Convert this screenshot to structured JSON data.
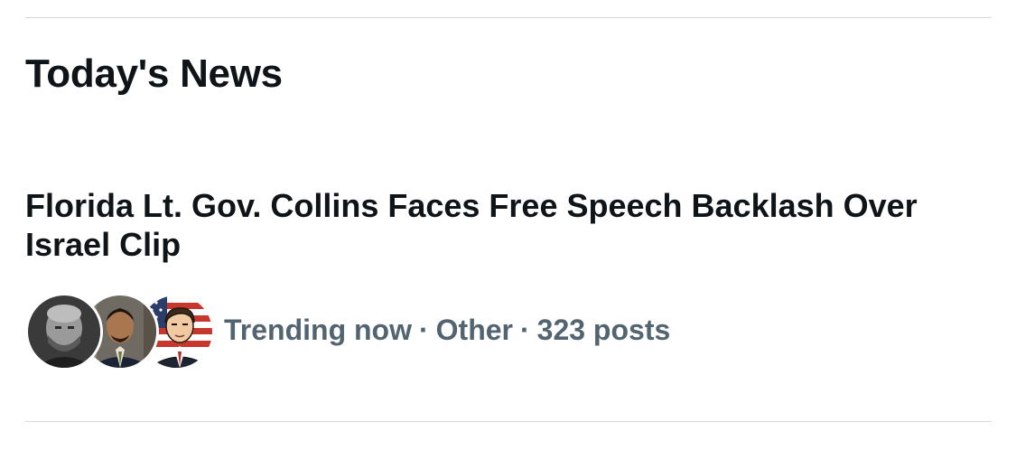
{
  "section": {
    "title": "Today's News"
  },
  "story": {
    "headline": "Florida Lt. Gov. Collins Faces Free Speech Backlash Over Israel Clip",
    "meta": {
      "status": "Trending now",
      "category": "Other",
      "post_count": "323 posts",
      "separator": "·"
    },
    "avatars": [
      {
        "icon": "person-photo-grayscale-avatar"
      },
      {
        "icon": "person-photo-suit-avatar"
      },
      {
        "icon": "cartoon-man-flag-avatar"
      }
    ]
  },
  "colors": {
    "primary_text": "#0f1419",
    "secondary_text": "#536471",
    "divider": "#d6dadd",
    "background": "#ffffff"
  }
}
